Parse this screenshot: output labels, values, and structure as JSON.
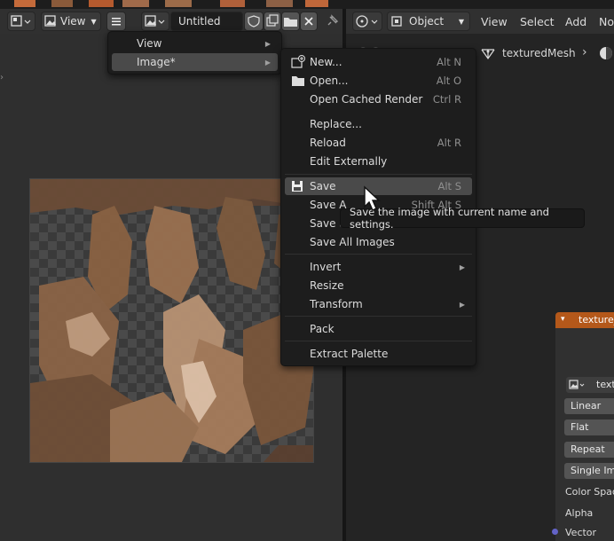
{
  "image_editor": {
    "view_menu": "View",
    "image_name": "Untitled",
    "texture_alt": "texture image"
  },
  "viewport": {
    "mode": "Object",
    "menus": [
      "View",
      "Select",
      "Add",
      "No"
    ],
    "object_name": "texturedMesh"
  },
  "hamburger_menu": {
    "items": [
      {
        "label": "View"
      },
      {
        "label": "Image*"
      }
    ]
  },
  "image_menu": {
    "items": [
      {
        "label": "New...",
        "shortcut": "Alt N"
      },
      {
        "label": "Open...",
        "shortcut": "Alt O"
      },
      {
        "label": "Open Cached Render",
        "shortcut": "Ctrl R"
      },
      {
        "label": "Replace...",
        "shortcut": ""
      },
      {
        "label": "Reload",
        "shortcut": "Alt R"
      },
      {
        "label": "Edit Externally",
        "shortcut": ""
      },
      {
        "label": "Save",
        "shortcut": "Alt S"
      },
      {
        "label": "Save A",
        "shortcut": "Shift Alt S"
      },
      {
        "label": "Save a",
        "shortcut": ""
      },
      {
        "label": "Save All Images",
        "shortcut": ""
      },
      {
        "label": "Invert",
        "shortcut": ""
      },
      {
        "label": "Resize",
        "shortcut": ""
      },
      {
        "label": "Transform",
        "shortcut": ""
      },
      {
        "label": "Pack",
        "shortcut": ""
      },
      {
        "label": "Extract Palette",
        "shortcut": ""
      }
    ]
  },
  "tooltip": "Save the image with current name and settings.",
  "node": {
    "title": "texture_",
    "image_field": "text",
    "interpolation": "Linear",
    "projection": "Flat",
    "extension": "Repeat",
    "source": "Single Im",
    "color_space_label": "Color Spac",
    "alpha_label": "Alpha",
    "vector_label": "Vector"
  },
  "colors": {
    "highlight": "#4a4a4a",
    "node_header": "#b4581a",
    "socket_vector": "#6363c7"
  }
}
